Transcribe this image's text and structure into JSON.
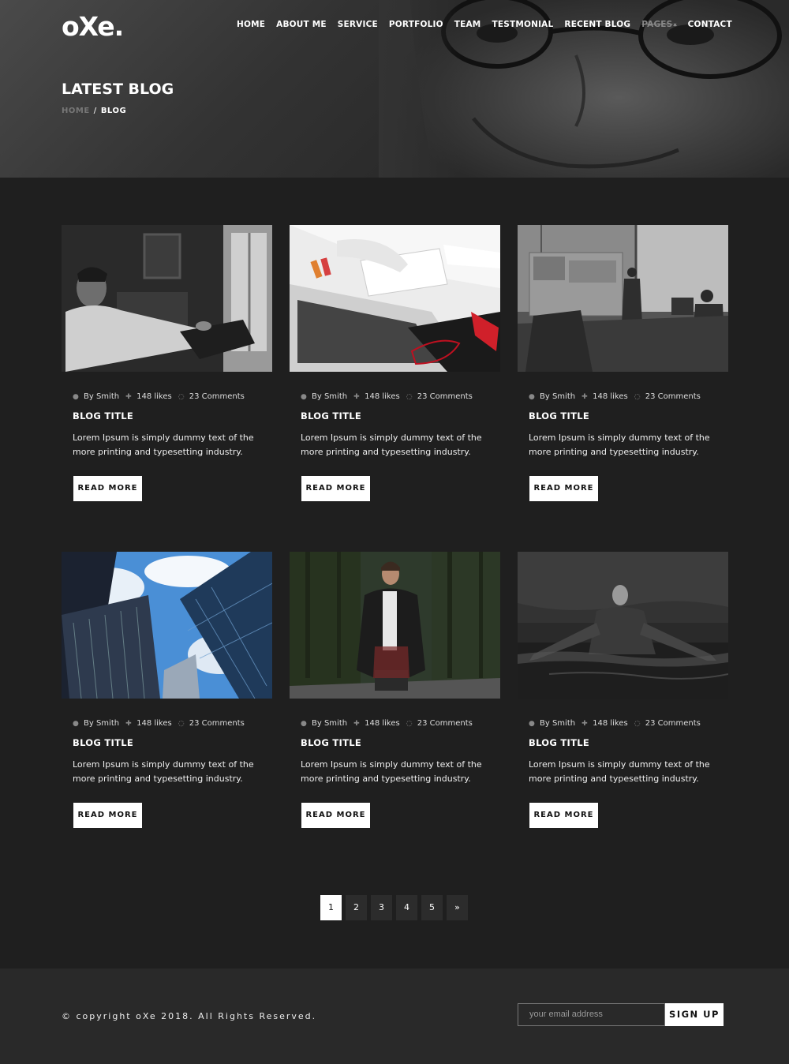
{
  "brand": {
    "logo": "oXe."
  },
  "nav": [
    {
      "label": "HOME"
    },
    {
      "label": "ABOUT ME"
    },
    {
      "label": "SERVICE"
    },
    {
      "label": "PORTFOLIO"
    },
    {
      "label": "TEAM"
    },
    {
      "label": "TESTMONIAL"
    },
    {
      "label": "RECENT BLOG"
    },
    {
      "label": "PAGES"
    },
    {
      "label": "CONTACT"
    }
  ],
  "hero": {
    "title": "LATEST BLOG",
    "breadcrumb": {
      "home": "HOME",
      "separator": "/",
      "current": "BLOG"
    }
  },
  "posts": [
    {
      "author": "By Smith",
      "likes": "148 likes",
      "comments": "23 Comments",
      "title": "BLOG TITLE",
      "excerpt": "Lorem Ipsum is simply dummy text of the more printing and typesetting industry.",
      "cta": "READ MORE"
    },
    {
      "author": "By Smith",
      "likes": "148 likes",
      "comments": "23 Comments",
      "title": "BLOG TITLE",
      "excerpt": "Lorem Ipsum is simply dummy text of the more printing and typesetting industry.",
      "cta": "READ MORE"
    },
    {
      "author": "By Smith",
      "likes": "148 likes",
      "comments": "23 Comments",
      "title": "BLOG TITLE",
      "excerpt": "Lorem Ipsum is simply dummy text of the more printing and typesetting industry.",
      "cta": "READ MORE"
    },
    {
      "author": "By Smith",
      "likes": "148 likes",
      "comments": "23 Comments",
      "title": "BLOG TITLE",
      "excerpt": "Lorem Ipsum is simply dummy text of the more printing and typesetting industry.",
      "cta": "READ MORE"
    },
    {
      "author": "By Smith",
      "likes": "148 likes",
      "comments": "23 Comments",
      "title": "BLOG TITLE",
      "excerpt": "Lorem Ipsum is simply dummy text of the more printing and typesetting industry.",
      "cta": "READ MORE"
    },
    {
      "author": "By Smith",
      "likes": "148 likes",
      "comments": "23 Comments",
      "title": "BLOG TITLE",
      "excerpt": "Lorem Ipsum is simply dummy text of the more printing and typesetting industry.",
      "cta": "READ MORE"
    }
  ],
  "pagination": {
    "pages": [
      "1",
      "2",
      "3",
      "4",
      "5"
    ],
    "next": "»",
    "active": "1"
  },
  "footer": {
    "copyright": "© copyright oXe 2018. All Rights Reserved.",
    "email_placeholder": "your email address",
    "signup_label": "SIGN UP"
  },
  "icons": {
    "author": "user-icon",
    "likes": "thumbs-up-icon",
    "comments": "comment-icon",
    "caret": "caret-down-icon"
  },
  "colors": {
    "background": "#1f1f1f",
    "footer": "#292929",
    "accent": "#ffffff"
  }
}
